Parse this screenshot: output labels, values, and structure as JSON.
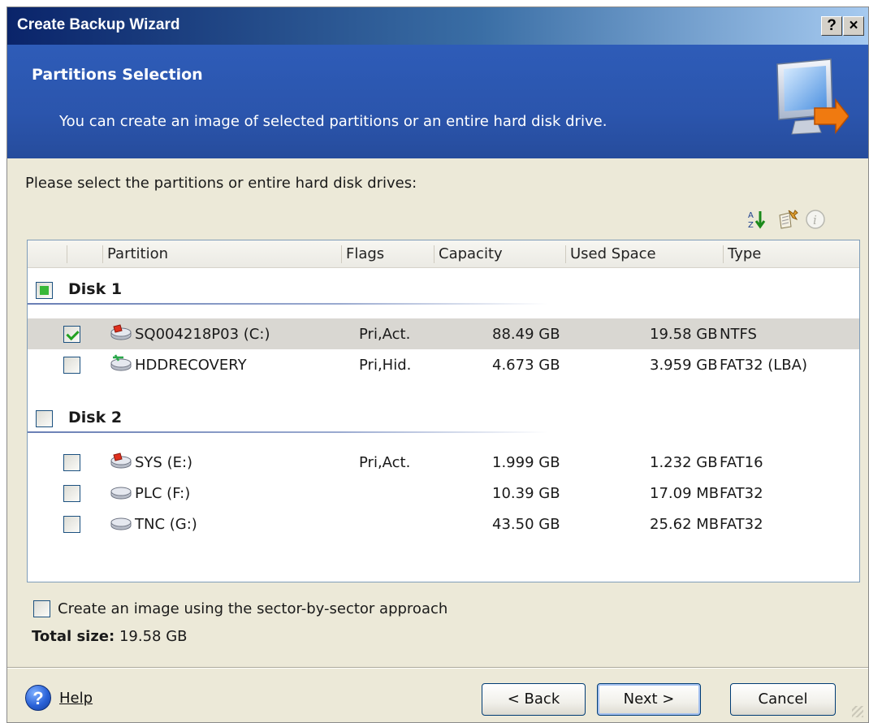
{
  "window": {
    "title": "Create Backup Wizard",
    "help_glyph": "?",
    "close_glyph": "×"
  },
  "header": {
    "title": "Partitions Selection",
    "subtitle": "You can create an image of selected partitions or an entire hard disk drive.",
    "icon": "monitor-arrow-icon"
  },
  "instructions": "Please select the partitions or entire hard disk drives:",
  "toolbar_icons": [
    "sort-icon",
    "properties-icon",
    "info-icon"
  ],
  "columns": [
    "Partition",
    "Flags",
    "Capacity",
    "Used Space",
    "Type"
  ],
  "disks": [
    {
      "label": "Disk 1",
      "state": "partial",
      "partitions": [
        {
          "name": "SQ004218P03 (C:)",
          "flags": "Pri,Act.",
          "capacity": "88.49 GB",
          "used": "19.58 GB",
          "type": "NTFS",
          "checked": true,
          "selected": true,
          "icon": "partition-active-icon"
        },
        {
          "name": "HDDRECOVERY",
          "flags": "Pri,Hid.",
          "capacity": "4.673 GB",
          "used": "3.959 GB",
          "type": "FAT32 (LBA)",
          "checked": false,
          "selected": false,
          "icon": "partition-hidden-icon"
        }
      ]
    },
    {
      "label": "Disk 2",
      "state": "unchecked",
      "partitions": [
        {
          "name": "SYS (E:)",
          "flags": "Pri,Act.",
          "capacity": "1.999 GB",
          "used": "1.232 GB",
          "type": "FAT16",
          "checked": false,
          "selected": false,
          "icon": "partition-active-icon"
        },
        {
          "name": "PLC (F:)",
          "flags": "",
          "capacity": "10.39 GB",
          "used": "17.09 MB",
          "type": "FAT32",
          "checked": false,
          "selected": false,
          "icon": "partition-icon"
        },
        {
          "name": "TNC (G:)",
          "flags": "",
          "capacity": "43.50 GB",
          "used": "25.62 MB",
          "type": "FAT32",
          "checked": false,
          "selected": false,
          "icon": "partition-icon"
        }
      ]
    }
  ],
  "sector_option": {
    "label": "Create an image using the sector-by-sector approach",
    "checked": false
  },
  "total": {
    "label": "Total size:",
    "value": "19.58 GB"
  },
  "footer": {
    "help_label": "Help",
    "back_label": "< Back",
    "next_label": "Next >",
    "cancel_label": "Cancel"
  },
  "colors": {
    "title_bar": "#0a246a",
    "header_band": "#2b55ad",
    "selection": "#d9d7d2",
    "check": "#21a121"
  }
}
